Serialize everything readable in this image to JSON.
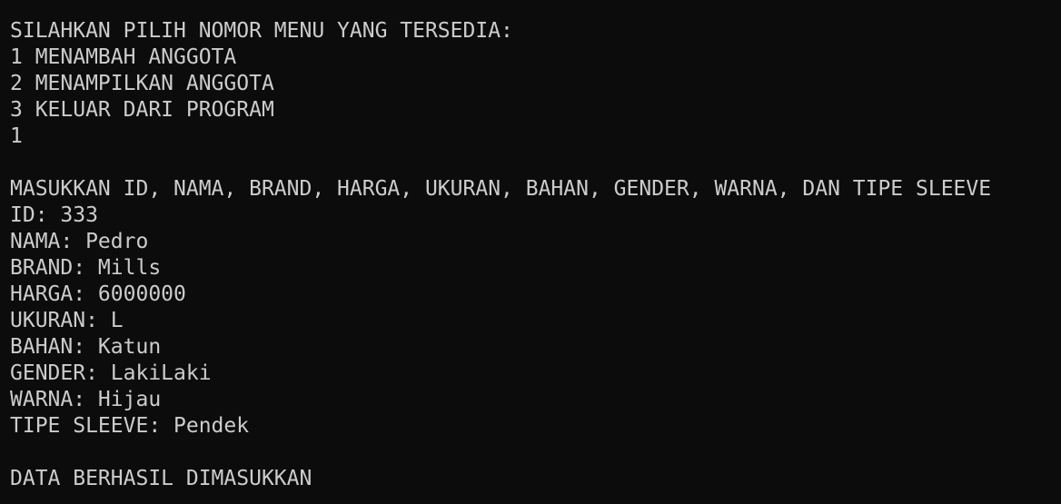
{
  "terminal": {
    "lines": [
      "SILAHKAN PILIH NOMOR MENU YANG TERSEDIA:",
      "1 MENAMBAH ANGGOTA",
      "2 MENAMPILKAN ANGGOTA",
      "3 KELUAR DARI PROGRAM",
      "1",
      "",
      "MASUKKAN ID, NAMA, BRAND, HARGA, UKURAN, BAHAN, GENDER, WARNA, DAN TIPE SLEEVE",
      "ID: 333",
      "NAMA: Pedro",
      "BRAND: Mills",
      "HARGA: 6000000",
      "UKURAN: L",
      "BAHAN: Katun",
      "GENDER: LakiLaki",
      "WARNA: Hijau",
      "TIPE SLEEVE: Pendek",
      "",
      "DATA BERHASIL DIMASUKKAN"
    ]
  },
  "colors": {
    "background": "#0c0c0c",
    "text": "#cccccc"
  }
}
